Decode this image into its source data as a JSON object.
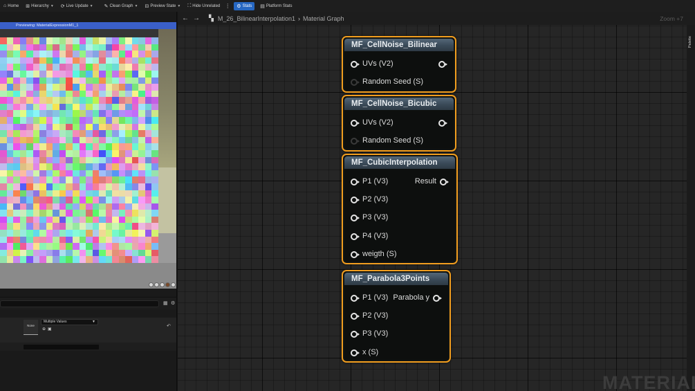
{
  "toolbar": {
    "items": [
      {
        "icon": "home-icon",
        "label": "Home",
        "dropdown": false
      },
      {
        "icon": "hierarchy-icon",
        "label": "Hierarchy",
        "dropdown": true
      },
      {
        "icon": "live-update-icon",
        "label": "Live Update",
        "dropdown": true
      },
      {
        "icon": "clean-graph-icon",
        "label": "Clean Graph",
        "dropdown": true
      },
      {
        "icon": "preview-state-icon",
        "label": "Preview State",
        "dropdown": true
      },
      {
        "icon": "hide-unrelated-icon",
        "label": "Hide Unrelated",
        "dropdown": false
      },
      {
        "icon": "stats-icon",
        "label": "Stats",
        "dropdown": false,
        "active": true
      },
      {
        "icon": "platform-stats-icon",
        "label": "Platform Stats",
        "dropdown": false
      }
    ]
  },
  "preview": {
    "label": "Previewing: MaterialExpressionM1_1"
  },
  "details": {
    "none_label": "None",
    "multi_value": "Multiple Values"
  },
  "graph": {
    "breadcrumb": [
      "M_26_BilinearInterpolation1",
      "Material Graph"
    ],
    "zoom": "Zoom +7",
    "palette_label": "Palette",
    "watermark": "MATERIAL",
    "nodes": [
      {
        "title": "MF_CellNoise_Bilinear",
        "inputs": [
          {
            "label": "UVs (V2)",
            "connected": true
          },
          {
            "label": "Random Seed (S)",
            "connected": false
          }
        ],
        "output": ""
      },
      {
        "title": "MF_CellNoise_Bicubic",
        "inputs": [
          {
            "label": "UVs (V2)",
            "connected": true
          },
          {
            "label": "Random Seed (S)",
            "connected": false
          }
        ],
        "output": ""
      },
      {
        "title": "MF_CubicInterpolation",
        "inputs": [
          {
            "label": "P1 (V3)",
            "connected": true
          },
          {
            "label": "P2 (V3)",
            "connected": true
          },
          {
            "label": "P3 (V3)",
            "connected": true
          },
          {
            "label": "P4 (V3)",
            "connected": true
          },
          {
            "label": "weigth (S)",
            "connected": true
          }
        ],
        "output": "Result"
      },
      {
        "title": "MF_Parabola3Points",
        "inputs": [
          {
            "label": "P1 (V3)",
            "connected": true
          },
          {
            "label": "P2 (V3)",
            "connected": true
          },
          {
            "label": "P3 (V3)",
            "connected": true
          },
          {
            "label": "x (S)",
            "connected": true
          }
        ],
        "output": "Parabola y"
      }
    ]
  }
}
